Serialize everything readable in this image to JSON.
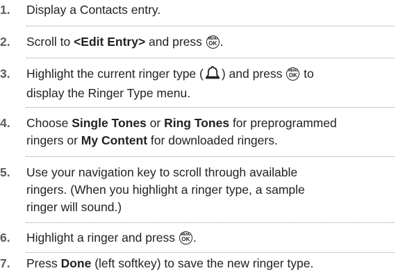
{
  "steps": [
    {
      "num": "1.",
      "text": "Display a Contacts entry."
    },
    {
      "num": "2.",
      "pre": "Scroll to ",
      "bold": "<Edit Entry>",
      "post": " and press",
      "end": "."
    },
    {
      "num": "3.",
      "pre": "Highlight the current ringer type (",
      "mid": ") and press",
      "line2a": " to",
      "line2": "display the Ringer Type menu."
    },
    {
      "num": "4.",
      "pre": "Choose ",
      "b1": "Single Tones",
      "or1": " or ",
      "b2": "Ring Tones",
      "post1": " for  preprogrammed",
      "line2pre": "ringers or ",
      "b3": "My Content",
      "line2post": " for downloaded ringers."
    },
    {
      "num": "5.",
      "line1": "Use your navigation key to scroll through available",
      "line2": "ringers. (When you highlight a ringer type, a sample",
      "line3": "ringer will sound.)"
    },
    {
      "num": "6.",
      "pre": "Highlight a ringer and press",
      "end": "."
    },
    {
      "num": "7.",
      "pre": "Press ",
      "bold": "Done",
      "post": " (left softkey) to save the new ringer type."
    }
  ],
  "icons": {
    "menu_ok_top": "MENU",
    "menu_ok_bottom": "OK",
    "ringer_icon": "bell-icon"
  }
}
